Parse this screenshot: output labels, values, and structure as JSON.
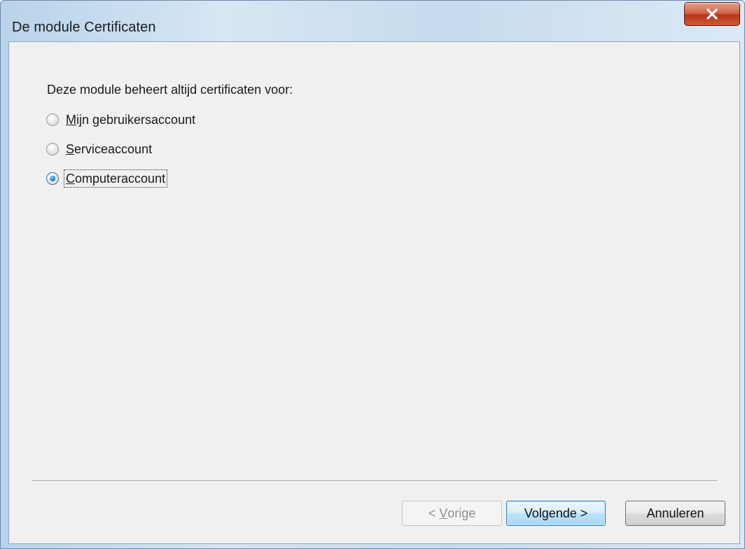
{
  "window": {
    "title": "De module Certificaten"
  },
  "content": {
    "prompt": "Deze module beheert altijd certificaten voor:",
    "options": [
      {
        "accesskey": "M",
        "rest": "ijn gebruikersaccount",
        "checked": false
      },
      {
        "accesskey": "S",
        "rest": "erviceaccount",
        "checked": false
      },
      {
        "accesskey": "C",
        "rest": "omputeraccount",
        "checked": true
      }
    ]
  },
  "buttons": {
    "back_prefix": "< ",
    "back_accesskey": "V",
    "back_rest": "orige",
    "next_label": "Volgende >",
    "cancel_label": "Annuleren"
  },
  "icons": {
    "close": "close-icon"
  },
  "colors": {
    "close_button": "#c7432a",
    "selected_radio": "#2a7fd0",
    "dialog_background": "#f0f0f0"
  }
}
